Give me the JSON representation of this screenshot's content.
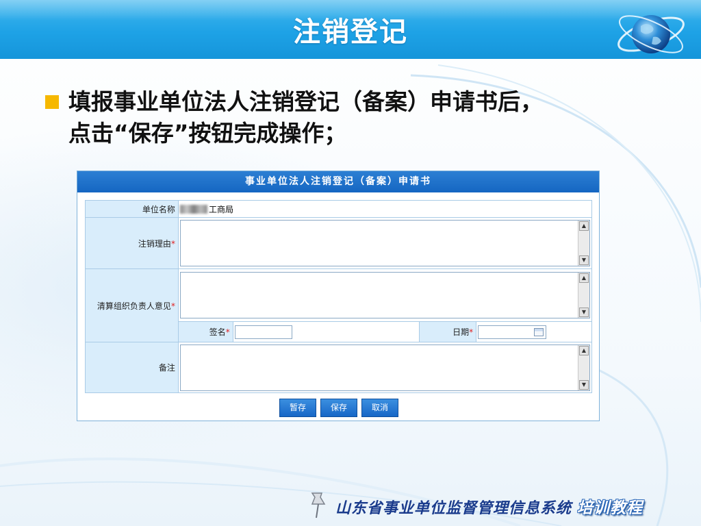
{
  "slide": {
    "title": "注销登记",
    "bullet_line1": "填报事业单位法人注销登记（备案）申请书后，",
    "bullet_line2": "点击“保存”按钮完成操作；"
  },
  "form": {
    "title": "事业单位法人注销登记（备案）申请书",
    "unit_name_label": "单位名称",
    "unit_name_value": "工商局",
    "reason_label": "注销理由",
    "liquidation_label": "清算组织负责人意见",
    "signature_label": "签名",
    "date_label": "日期",
    "remarks_label": "备注",
    "required_mark": "*"
  },
  "buttons": {
    "temp_save": "暂存",
    "save": "保存",
    "cancel": "取消"
  },
  "footer": {
    "system_name": "山东省事业单位监督管理信息系统",
    "badge": "培训教程"
  },
  "colors": {
    "header": "#1ea2e6",
    "bullet": "#f6b800",
    "panel_title": "#1566c2",
    "label_bg": "#d9edfb",
    "footer_text": "#1a3b8c"
  },
  "icons": [
    "globe-icon",
    "scroll-up-arrow-icon",
    "scroll-down-arrow-icon",
    "calendar-icon",
    "pushpin-icon"
  ]
}
